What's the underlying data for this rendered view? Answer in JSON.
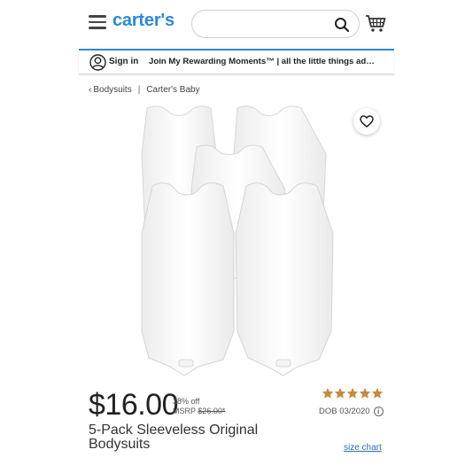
{
  "header": {
    "logo": "carter's",
    "search": {
      "value": "",
      "placeholder": ""
    },
    "icons": [
      "hamburger-menu-icon",
      "search-icon",
      "cart-icon"
    ],
    "accent_color": "#2b8ad6"
  },
  "promo_bar": {
    "signin_label": "Sign in",
    "message": "Join My Rewarding Moments™ | all the little things ad…"
  },
  "breadcrumb": {
    "items": [
      "Bodysuits",
      "Carter's Baby"
    ],
    "separator": "|"
  },
  "product": {
    "price": "$16.00",
    "discount": "38% off",
    "msrp_label": "MSRP",
    "msrp_value": "$26.00*",
    "rating_stars": 5,
    "star_color": "#c68a3c",
    "dob": "DOB 03/2020",
    "title": "5-Pack Sleeveless Original Bodysuits",
    "size_chart_label": "size chart"
  }
}
